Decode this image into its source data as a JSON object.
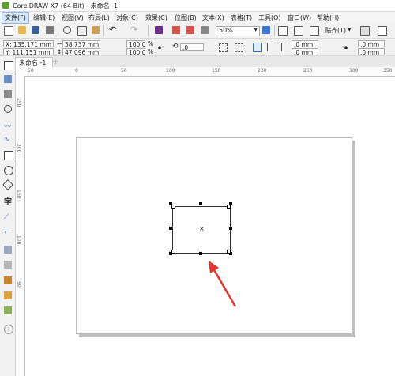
{
  "window": {
    "title": "CorelDRAW X7 (64-Bit) - 未命名 -1"
  },
  "menu": [
    {
      "id": "file",
      "label": "文件(F)"
    },
    {
      "id": "edit",
      "label": "编辑(E)"
    },
    {
      "id": "view",
      "label": "视图(V)"
    },
    {
      "id": "layout",
      "label": "布局(L)"
    },
    {
      "id": "object",
      "label": "对象(C)"
    },
    {
      "id": "effects",
      "label": "效果(C)"
    },
    {
      "id": "bitmaps",
      "label": "位图(B)"
    },
    {
      "id": "text",
      "label": "文本(X)"
    },
    {
      "id": "table",
      "label": "表格(T)"
    },
    {
      "id": "tools",
      "label": "工具(O)"
    },
    {
      "id": "window",
      "label": "窗口(W)"
    },
    {
      "id": "help",
      "label": "帮助(H)"
    }
  ],
  "toolbar": {
    "zoom": "50%",
    "snap_label": "贴齐(T)"
  },
  "properties": {
    "x": "X: 135.171 mm",
    "y": "Y: 111.151 mm",
    "width": "58.737 mm",
    "height": "47.096 mm",
    "scale_w": "100.0",
    "scale_h": "100.0",
    "percent": "%",
    "rotation": ".0",
    "corner_1": ".0 mm",
    "corner_2": ".0 mm",
    "corner_3": ".0 mm",
    "corner_4": ".0 mm"
  },
  "document_tab": {
    "label": "未命名 -1",
    "add_symbol": "+"
  },
  "ruler": {
    "top_ticks": [
      "50",
      "0",
      "50",
      "100",
      "150",
      "200",
      "250",
      "300",
      "350"
    ],
    "left_ticks": [
      "250",
      "200",
      "150",
      "100",
      "50"
    ]
  },
  "selection": {
    "center_mark": "×"
  },
  "colors": {
    "accent_arrow": "#e8332a",
    "page_shadow": "#bfbfbf"
  }
}
